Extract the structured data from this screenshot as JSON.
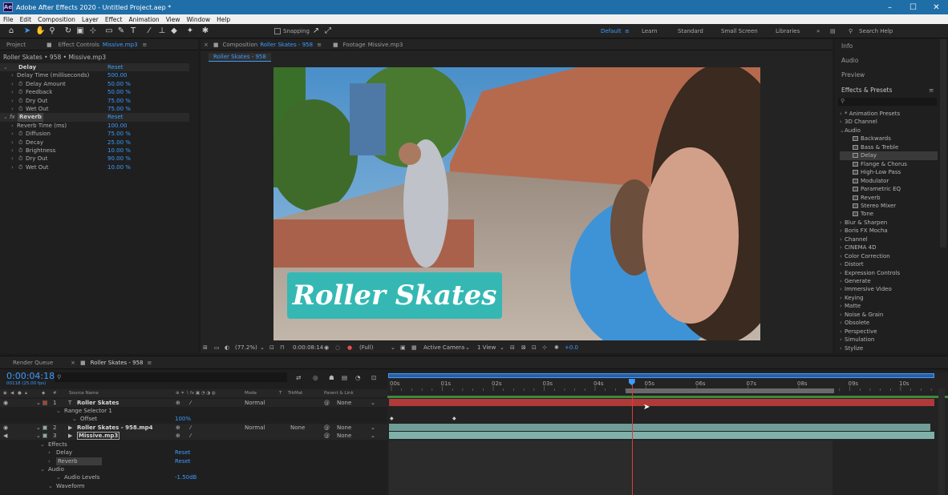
{
  "titlebar": {
    "title": "Adobe After Effects 2020 - Untitled Project.aep *",
    "app_icon": "Ae",
    "minimize": "–",
    "maximize": "☐",
    "close": "✕"
  },
  "menu": [
    "File",
    "Edit",
    "Composition",
    "Layer",
    "Effect",
    "Animation",
    "View",
    "Window",
    "Help"
  ],
  "toolbar": {
    "snapping": "Snapping",
    "workspaces": [
      "Default",
      "Learn",
      "Standard",
      "Small Screen",
      "Libraries"
    ],
    "search_placeholder": "Search Help"
  },
  "left_panel": {
    "tab_project": "Project",
    "tab_effect_controls": "Effect Controls",
    "ec_layer": "Missive.mp3",
    "breadcrumb": "Roller Skates • 958 • Missive.mp3",
    "delay": {
      "name": "Delay",
      "reset": "Reset",
      "props": [
        {
          "label": "Delay Time (milliseconds)",
          "value": "500.00",
          "stopwatch": false
        },
        {
          "label": "Delay Amount",
          "value": "50.00 %",
          "stopwatch": true
        },
        {
          "label": "Feedback",
          "value": "50.00 %",
          "stopwatch": true
        },
        {
          "label": "Dry Out",
          "value": "75.00 %",
          "stopwatch": true
        },
        {
          "label": "Wet Out",
          "value": "75.00 %",
          "stopwatch": true
        }
      ]
    },
    "reverb": {
      "name": "Reverb",
      "fx": "fx",
      "reset": "Reset",
      "props": [
        {
          "label": "Reverb Time (ms)",
          "value": "100.00",
          "stopwatch": false
        },
        {
          "label": "Diffusion",
          "value": "75.00 %",
          "stopwatch": true
        },
        {
          "label": "Decay",
          "value": "25.00 %",
          "stopwatch": true
        },
        {
          "label": "Brightness",
          "value": "10.00 %",
          "stopwatch": true
        },
        {
          "label": "Dry Out",
          "value": "90.00 %",
          "stopwatch": true
        },
        {
          "label": "Wet Out",
          "value": "10.00 %",
          "stopwatch": true
        }
      ]
    }
  },
  "comp": {
    "tab_comp": "Composition",
    "comp_name": "Roller Skates - 958",
    "tab_footage": "Footage",
    "footage_name": "Missive.mp3",
    "flow_tab": "Roller Skates - 958",
    "overlay_title": "Roller Skates",
    "footer": {
      "zoom": "(77.2%)",
      "timecode": "0:00:08:14",
      "resolution": "(Full)",
      "camera": "Active Camera",
      "views": "1 View",
      "exposure": "+0.0"
    }
  },
  "right_panel": {
    "info": "Info",
    "audio": "Audio",
    "preview": "Preview",
    "effects_presets": "Effects & Presets",
    "items": [
      {
        "label": "* Animation Presets",
        "type": "cat",
        "open": false
      },
      {
        "label": "3D Channel",
        "type": "cat",
        "open": false
      },
      {
        "label": "Audio",
        "type": "cat",
        "open": true
      },
      {
        "label": "Backwards",
        "type": "fx"
      },
      {
        "label": "Bass & Treble",
        "type": "fx"
      },
      {
        "label": "Delay",
        "type": "fx",
        "selected": true
      },
      {
        "label": "Flange & Chorus",
        "type": "fx"
      },
      {
        "label": "High-Low Pass",
        "type": "fx"
      },
      {
        "label": "Modulator",
        "type": "fx"
      },
      {
        "label": "Parametric EQ",
        "type": "fx"
      },
      {
        "label": "Reverb",
        "type": "fx"
      },
      {
        "label": "Stereo Mixer",
        "type": "fx"
      },
      {
        "label": "Tone",
        "type": "fx"
      },
      {
        "label": "Blur & Sharpen",
        "type": "cat",
        "open": false
      },
      {
        "label": "Boris FX Mocha",
        "type": "cat",
        "open": false
      },
      {
        "label": "Channel",
        "type": "cat",
        "open": false
      },
      {
        "label": "CINEMA 4D",
        "type": "cat",
        "open": false
      },
      {
        "label": "Color Correction",
        "type": "cat",
        "open": false
      },
      {
        "label": "Distort",
        "type": "cat",
        "open": false
      },
      {
        "label": "Expression Controls",
        "type": "cat",
        "open": false
      },
      {
        "label": "Generate",
        "type": "cat",
        "open": false
      },
      {
        "label": "Immersive Video",
        "type": "cat",
        "open": false
      },
      {
        "label": "Keying",
        "type": "cat",
        "open": false
      },
      {
        "label": "Matte",
        "type": "cat",
        "open": false
      },
      {
        "label": "Noise & Grain",
        "type": "cat",
        "open": false
      },
      {
        "label": "Obsolete",
        "type": "cat",
        "open": false
      },
      {
        "label": "Perspective",
        "type": "cat",
        "open": false
      },
      {
        "label": "Simulation",
        "type": "cat",
        "open": false
      },
      {
        "label": "Stylize",
        "type": "cat",
        "open": false
      }
    ]
  },
  "timeline": {
    "tab_render": "Render Queue",
    "tab_comp": "Roller Skates - 958",
    "timecode": "0:00:04:18",
    "frames": "00118 (25.00 fps)",
    "col_source": "Source Name",
    "col_mode": "Mode",
    "col_t": "T",
    "col_trkmat": "TrkMat",
    "col_parent": "Parent & Link",
    "rows": [
      {
        "num": "1",
        "type": "T",
        "name": "Roller Skates",
        "mode": "Normal",
        "trkmat": "",
        "parent": "None"
      },
      {
        "sub": "Range Selector 1"
      },
      {
        "sub": "Offset",
        "value": "100%"
      },
      {
        "num": "2",
        "type": "▶",
        "name": "Roller Skates - 958.mp4",
        "mode": "Normal",
        "trkmat": "None",
        "parent": "None"
      },
      {
        "num": "3",
        "type": "▶",
        "name": "Missive.mp3",
        "mode": "",
        "trkmat": "",
        "parent": "None"
      },
      {
        "sub": "Effects"
      },
      {
        "sub": "Delay",
        "value": "Reset"
      },
      {
        "sub": "Reverb",
        "value": "Reset"
      },
      {
        "sub": "Audio"
      },
      {
        "sub": "Audio Levels",
        "value": "-1.50dB"
      },
      {
        "sub": "Waveform"
      }
    ],
    "ruler": [
      "00s",
      "01s",
      "02s",
      "03s",
      "04s",
      "05s",
      "06s",
      "07s",
      "08s",
      "09s",
      "10s"
    ],
    "playhead_seconds": 4.72
  }
}
